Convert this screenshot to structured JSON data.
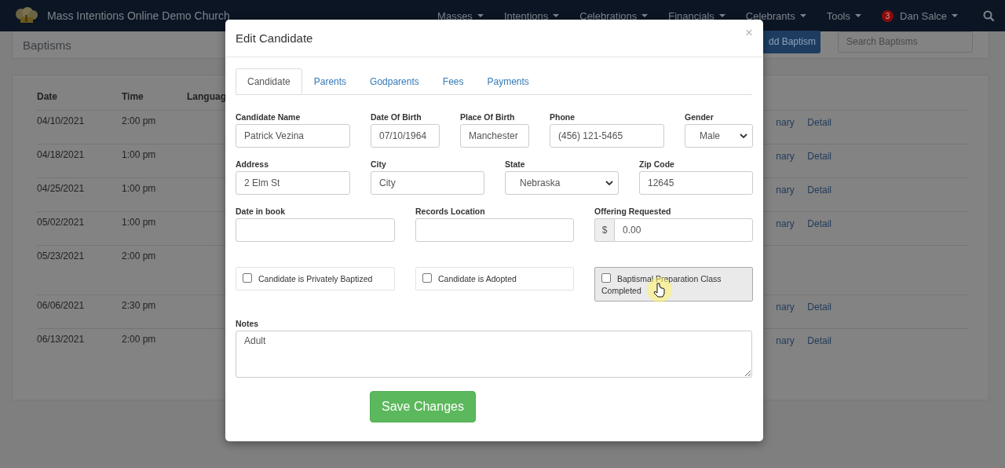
{
  "navbar": {
    "brand": "Mass Intentions Online Demo Church",
    "menus": [
      {
        "label": "Masses"
      },
      {
        "label": "Intentions"
      },
      {
        "label": "Celebrations"
      },
      {
        "label": "Financials"
      },
      {
        "label": "Celebrants"
      },
      {
        "label": "Tools"
      }
    ],
    "user": {
      "badge": "3",
      "name": "Dan Salce"
    }
  },
  "page": {
    "title": "Baptisms",
    "add_button": "dd Baptism",
    "search": {
      "placeholder": "Search Baptisms"
    },
    "columns": [
      "Date",
      "Time",
      "Languag"
    ],
    "rows": [
      {
        "date": "04/10/2021",
        "time": "2:00 pm",
        "links": [
          "nary",
          "Detail"
        ]
      },
      {
        "date": "04/18/2021",
        "time": "1:00 pm",
        "links": [
          "nary",
          "Detail"
        ]
      },
      {
        "date": "04/25/2021",
        "time": "1:00 pm",
        "links": [
          "nary",
          "Detail"
        ]
      },
      {
        "date": "05/02/2021",
        "time": "1:00 pm",
        "links": [
          "nary",
          "Detail"
        ]
      },
      {
        "date": "05/23/2021",
        "time": "2:00 pm"
      },
      {
        "date": "06/06/2021",
        "time": "2:30 pm",
        "links": [
          "nary",
          "Detail"
        ]
      },
      {
        "date": "06/13/2021",
        "time": "2:00 pm",
        "links": [
          "nary",
          "Detail"
        ]
      }
    ]
  },
  "modal": {
    "title": "Edit Candidate",
    "close": "×",
    "tabs": [
      {
        "label": "Candidate",
        "selected": true
      },
      {
        "label": "Parents",
        "selected": false
      },
      {
        "label": "Godparents",
        "selected": false
      },
      {
        "label": "Fees",
        "selected": false
      },
      {
        "label": "Payments",
        "selected": false
      }
    ],
    "field_rows": [
      [
        {
          "label": "Candidate Name",
          "kind": "text",
          "value": "Patrick Vezina"
        },
        {
          "label": "Date Of Birth",
          "kind": "text",
          "value": "07/10/1964"
        },
        {
          "label": "Place Of Birth",
          "kind": "text",
          "value": "Manchester"
        },
        {
          "label": "Phone",
          "kind": "text",
          "value": "(456) 121-5465"
        },
        {
          "label": "Gender",
          "kind": "select",
          "value": "Male"
        }
      ],
      [
        {
          "label": "Address",
          "kind": "text",
          "value": "2 Elm St"
        },
        {
          "label": "City",
          "kind": "text",
          "placeholder": "City"
        },
        {
          "label": "State",
          "kind": "select",
          "value": "Nebraska"
        },
        {
          "label": "Zip Code",
          "kind": "text",
          "value": "12645"
        }
      ],
      [
        {
          "label": "Date in book",
          "kind": "text"
        },
        {
          "label": "Records Location",
          "kind": "text"
        },
        {
          "label": "Offering Requested",
          "kind": "money",
          "prefix": "$",
          "value": "0.00"
        }
      ]
    ],
    "checkboxes": [
      {
        "label": "Candidate is Privately Baptized",
        "checked": false,
        "hovered": false
      },
      {
        "label": "Candidate is Adopted",
        "checked": false,
        "hovered": false
      },
      {
        "label": "Baptismal Preparation Class Completed",
        "checked": false,
        "hovered": true
      }
    ],
    "notes": {
      "label": "Notes",
      "value": "Adult"
    },
    "save_button": "Save Changes"
  }
}
